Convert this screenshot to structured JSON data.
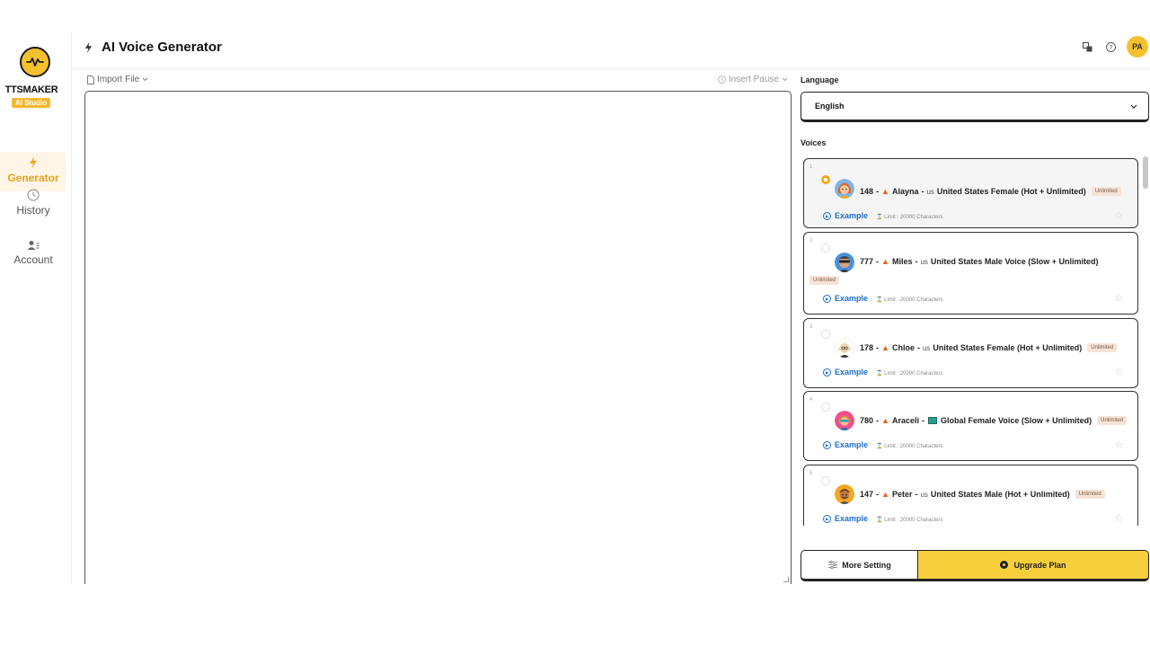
{
  "app": {
    "name": "TTSMAKER",
    "badge": "AI Studio"
  },
  "sidebar": {
    "items": [
      {
        "label": "Generator",
        "icon": "bolt-icon",
        "active": true
      },
      {
        "label": "History",
        "icon": "clock-icon",
        "active": false
      },
      {
        "label": "Account",
        "icon": "account-icon",
        "active": false
      }
    ]
  },
  "header": {
    "title": "AI Voice Generator",
    "avatar_initials": "PA"
  },
  "editor": {
    "import_label": "Import File",
    "insert_pause_label": "Insert Pause",
    "text": ""
  },
  "language": {
    "label": "Language",
    "selected": "English"
  },
  "voices": {
    "label": "Voices",
    "items": [
      {
        "index": "1",
        "id": "148",
        "name": "Alayna",
        "country_code": "us",
        "desc": "United States Female (Hot + Unlimited)",
        "badge": "Unlimited",
        "example": "Example",
        "limit": "Limit : 20000 Characters",
        "selected": true
      },
      {
        "index": "2",
        "id": "777",
        "name": "Miles",
        "country_code": "us",
        "desc": "United States Male Voice (Slow + Unlimited)",
        "badge": "Unlimited",
        "example": "Example",
        "limit": "Limit : 20000 Characters",
        "selected": false
      },
      {
        "index": "3",
        "id": "178",
        "name": "Chloe",
        "country_code": "us",
        "desc": "United States Female (Hot + Unlimited)",
        "badge": "Unlimited",
        "example": "Example",
        "limit": "Limit : 20000 Characters",
        "selected": false
      },
      {
        "index": "4",
        "id": "780",
        "name": "Araceli",
        "country_code": "",
        "desc": "Global Female Voice (Slow + Unlimited)",
        "badge": "Unlimited",
        "example": "Example",
        "limit": "Limit : 20000 Characters",
        "selected": false
      },
      {
        "index": "5",
        "id": "147",
        "name": "Peter",
        "country_code": "us",
        "desc": "United States Male (Hot + Unlimited)",
        "badge": "Unlimited",
        "example": "Example",
        "limit": "Limit : 20000 Characters",
        "selected": false
      }
    ]
  },
  "buttons": {
    "more_setting": "More Setting",
    "upgrade_plan": "Upgrade Plan"
  },
  "colors": {
    "accent": "#f5c12e",
    "link": "#1e6fc9",
    "upgrade_bg": "#f7cf3c",
    "badge_bg": "#f6e3d6"
  }
}
